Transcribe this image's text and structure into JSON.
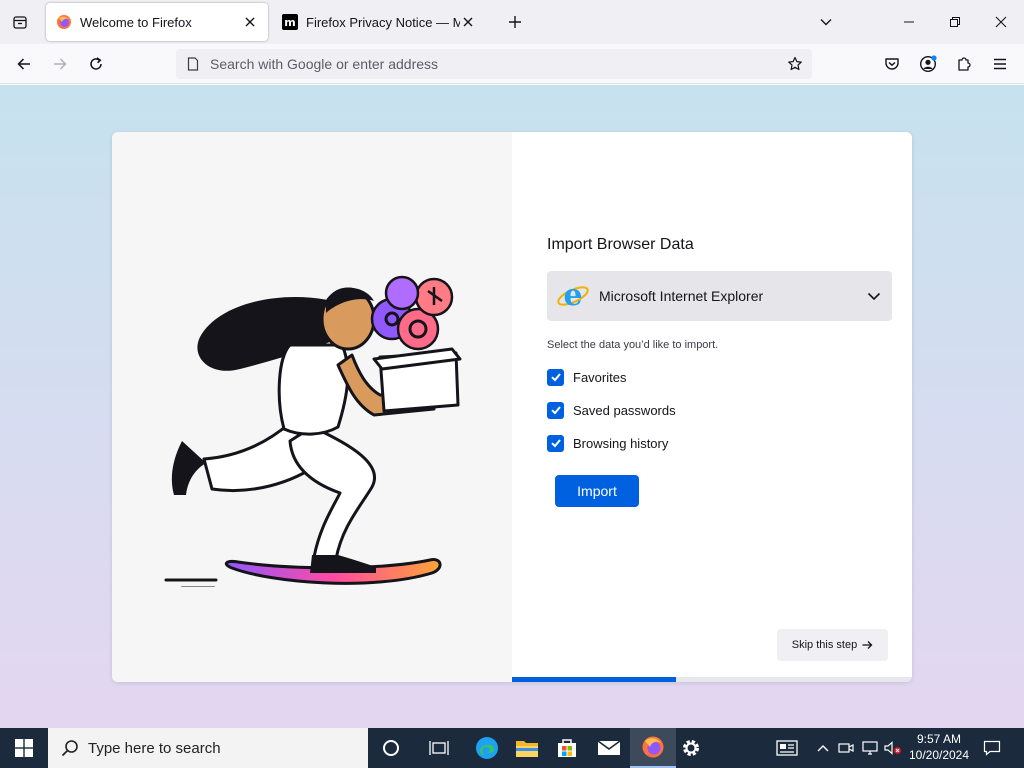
{
  "tabs": [
    {
      "title": "Welcome to Firefox",
      "active": true,
      "favicon": "firefox-icon"
    },
    {
      "title": "Firefox Privacy Notice — Mozilla",
      "active": false,
      "favicon": "mozilla-m-icon"
    }
  ],
  "mozilla_favicon_glyph": "m",
  "urlbar": {
    "placeholder": "Search with Google or enter address",
    "value": ""
  },
  "import": {
    "title": "Import Browser Data",
    "selected_browser": "Microsoft Internet Explorer",
    "browser_icon": "internet-explorer-icon",
    "instructions": "Select the data you’d like to import.",
    "options": [
      {
        "label": "Favorites",
        "checked": true
      },
      {
        "label": "Saved passwords",
        "checked": true
      },
      {
        "label": "Browsing history",
        "checked": true
      }
    ],
    "import_button": "Import",
    "skip_button": "Skip this step",
    "progress": 0.41
  },
  "taskbar": {
    "search_placeholder": "Type here to search",
    "time": "9:57 AM",
    "date": "10/20/2024",
    "pinned": [
      "cortana-icon",
      "task-view-icon",
      "edge-icon",
      "file-explorer-icon",
      "microsoft-store-icon",
      "mail-icon",
      "firefox-icon",
      "settings-icon"
    ]
  },
  "colors": {
    "accent": "#0061e0",
    "tab_strip": "#f0f0f4",
    "taskbar": "#1b2a3d",
    "page_gradient_top": "#c6e2ee",
    "page_gradient_bottom": "#e4d6f1"
  }
}
